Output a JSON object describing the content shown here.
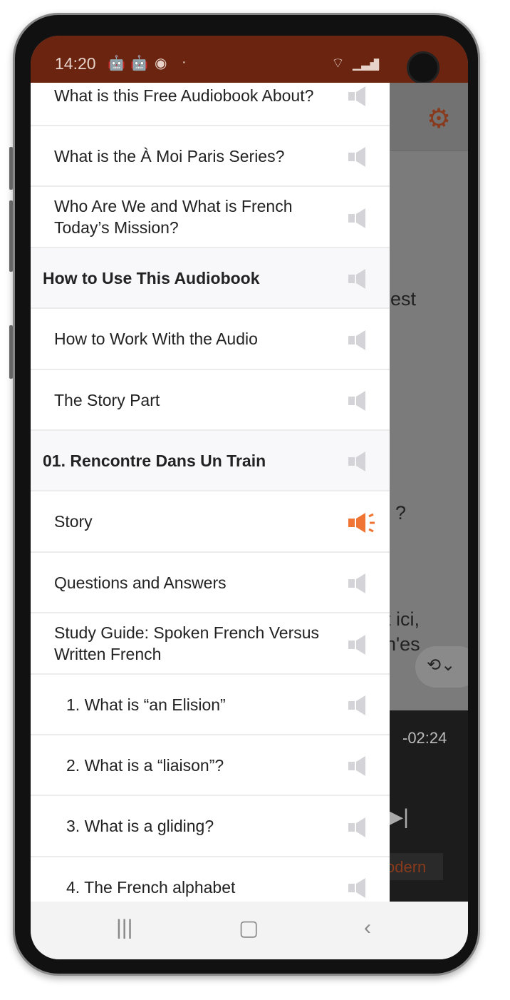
{
  "status_bar": {
    "time": "14:20",
    "icons": [
      "android-icon",
      "android-lock-icon",
      "firefox-icon",
      "dot-icon",
      "wifi-icon",
      "signal-icon",
      "battery-icon"
    ]
  },
  "background_app": {
    "settings_icon": "gear-icon",
    "text_fragments": [
      "est",
      "?",
      "t ici,",
      "n'es"
    ],
    "player": {
      "remaining_time": "-02:24",
      "badge": "odern"
    }
  },
  "drawer": {
    "items": [
      {
        "label": "What is this Free Audiobook About?",
        "type": "item"
      },
      {
        "label": "What is the À Moi Paris Series?",
        "type": "item"
      },
      {
        "label": "Who Are We and What is French Today’s Mission?",
        "type": "item"
      },
      {
        "label": "How to Use This Audiobook",
        "type": "header"
      },
      {
        "label": "How to Work With the Audio",
        "type": "item"
      },
      {
        "label": "The Story Part",
        "type": "item"
      },
      {
        "label": "01. Rencontre Dans Un Train",
        "type": "header"
      },
      {
        "label": "Story",
        "type": "item",
        "playing": true
      },
      {
        "label": "Questions and Answers",
        "type": "item"
      },
      {
        "label": "Study Guide: Spoken French Versus Written French",
        "type": "item"
      },
      {
        "label": "1. What is “an Elision”",
        "type": "sub"
      },
      {
        "label": "2. What is a “liaison”?",
        "type": "sub"
      },
      {
        "label": "3. What is a gliding?",
        "type": "sub"
      },
      {
        "label": "4. The French alphabet",
        "type": "sub"
      }
    ]
  },
  "colors": {
    "status_bar": "#6a2410",
    "active_speaker": "#f07534",
    "inactive_speaker": "#d4d4d8"
  },
  "nav_bar": {
    "buttons": [
      "recent-apps",
      "home",
      "back"
    ]
  }
}
